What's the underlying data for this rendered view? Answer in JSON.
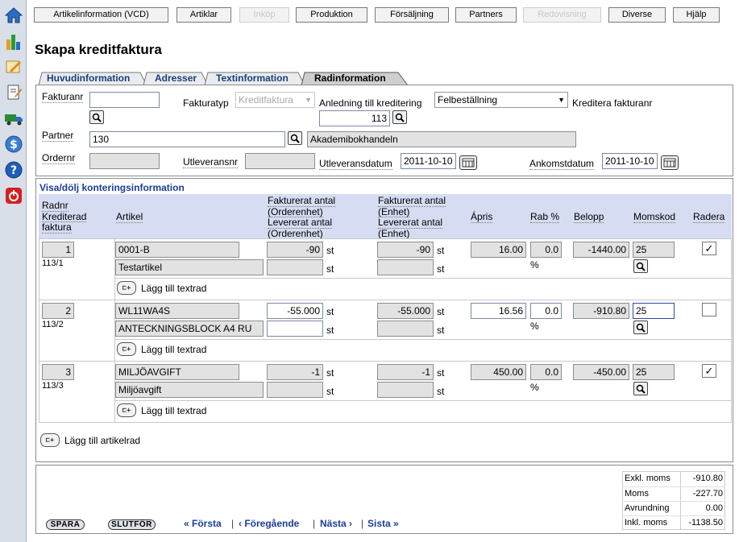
{
  "nav": [
    "Artikelinformation (VCD)",
    "Artiklar",
    "Inköp",
    "Produktion",
    "Försäljning",
    "Partners",
    "Redovisning",
    "Diverse",
    "Hjälp"
  ],
  "page_title": "Skapa kreditfaktura",
  "tabs": [
    "Huvudinformation",
    "Adresser",
    "Textinformation",
    "Radinformation"
  ],
  "header": {
    "fakturanr_label": "Fakturanr",
    "fakturatyp_label": "Fakturatyp",
    "fakturatyp_value": "Kreditfaktura",
    "anledning_label": "Anledning till kreditering",
    "anledning_value": "Felbeställning",
    "kreditera_label": "Kreditera fakturanr",
    "kreditera_value": "113",
    "partner_label": "Partner",
    "partner_value": "130",
    "partner_name": "Akademibokhandeln",
    "ordernr_label": "Ordernr",
    "utleveransnr_label": "Utleveransnr",
    "utleveransdatum_label": "Utleveransdatum",
    "utleveransdatum_value": "2011-10-10",
    "ankomstdatum_label": "Ankomstdatum",
    "ankomstdatum_value": "2011-10-10"
  },
  "toggle_label": "Visa/dölj konteringsinformation",
  "columns": {
    "radnr": [
      "Radnr",
      "Krediterad",
      "faktura"
    ],
    "artikel": "Artikel",
    "fakt_order": [
      "Fakturerat antal",
      "(Orderenhet)",
      "Levererat antal",
      "(Orderenhet)"
    ],
    "fakt_enhet": [
      "Fakturerat antal",
      "(Enhet)",
      "Levererat antal",
      "(Enhet)"
    ],
    "apris": "Ápris",
    "rab": "Rab %",
    "belopp": "Belopp",
    "momskod": "Momskod",
    "radera": "Radera"
  },
  "unit_st": "st",
  "unit_pct": "%",
  "add_text_label": "Lägg till textrad",
  "add_article_label": "Lägg till artikelrad",
  "rows": [
    {
      "radnr": "1",
      "ref": "113/1",
      "artikel": "0001-B",
      "beskrivning": "Testartikel",
      "fakt_order": "-90",
      "lev_order": "",
      "fakt_enhet": "-90",
      "lev_enhet": "",
      "apris": "16.00",
      "rab": "0.0",
      "belopp": "-1440.00",
      "momskod": "25",
      "radera": "✓"
    },
    {
      "radnr": "2",
      "ref": "113/2",
      "artikel": "WL11WA4S",
      "beskrivning": "ANTECKNINGSBLOCK A4 RU",
      "fakt_order": "-55.000",
      "lev_order": "",
      "fakt_enhet": "-55.000",
      "lev_enhet": "",
      "apris": "16.56",
      "rab": "0.0",
      "belopp": "-910.80",
      "momskod": "25",
      "radera": ""
    },
    {
      "radnr": "3",
      "ref": "113/3",
      "artikel": "MILJÖAVGIFT",
      "beskrivning": "Miljöavgift",
      "fakt_order": "-1",
      "lev_order": "",
      "fakt_enhet": "-1",
      "lev_enhet": "",
      "apris": "450.00",
      "rab": "0.0",
      "belopp": "-450.00",
      "momskod": "25",
      "radera": "✓"
    }
  ],
  "totals": [
    {
      "label": "Exkl. moms",
      "value": "-910.80"
    },
    {
      "label": "Moms",
      "value": "-227.70"
    },
    {
      "label": "Avrundning",
      "value": "0.00"
    },
    {
      "label": "Inkl. moms",
      "value": "-1138.50"
    }
  ],
  "buttons": {
    "spara": "SPARA",
    "slutfor": "SLUTFÖR"
  },
  "pager": {
    "first": "« Första",
    "prev": "‹ Föregående",
    "next": "Nästa ›",
    "last": "Sista »",
    "sep": "|"
  },
  "colors": {
    "link": "#1c3d9a",
    "header_bg": "#d6dcf1",
    "readonly": "#e2e2e2"
  }
}
